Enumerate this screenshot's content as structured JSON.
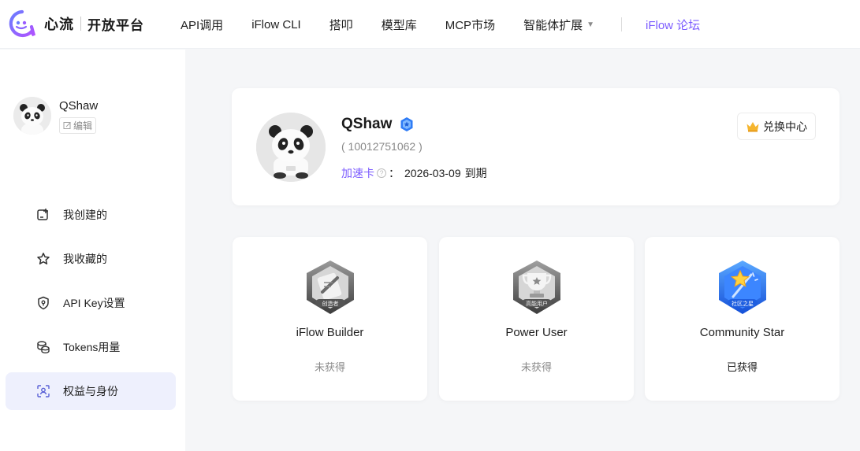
{
  "brand": {
    "name": "心流",
    "sub": "开放平台"
  },
  "nav": {
    "items": [
      {
        "label": "API调用"
      },
      {
        "label": "iFlow CLI"
      },
      {
        "label": "搭叩"
      },
      {
        "label": "模型库"
      },
      {
        "label": "MCP市场"
      },
      {
        "label": "智能体扩展"
      }
    ],
    "forum": "iFlow 论坛",
    "accent_color": "#7c5cff"
  },
  "sidebar": {
    "user": {
      "name": "QShaw",
      "edit_label": "编辑"
    },
    "menu": [
      {
        "label": "我创建的",
        "icon": "create-icon"
      },
      {
        "label": "我收藏的",
        "icon": "star-icon"
      },
      {
        "label": "API Key设置",
        "icon": "shield-key-icon"
      },
      {
        "label": "Tokens用量",
        "icon": "coins-icon"
      },
      {
        "label": "权益与身份",
        "icon": "identity-icon",
        "active": true
      }
    ]
  },
  "profile": {
    "name": "QShaw",
    "id": "( 10012751062 )",
    "card_label": "加速卡",
    "expiry_prefix": "：",
    "expiry_date": "2026-03-09",
    "expiry_suffix": "到期",
    "redeem_label": "兑换中心"
  },
  "badges": [
    {
      "title": "iFlow Builder",
      "badge_text": "创造者",
      "status": "未获得",
      "earned": false
    },
    {
      "title": "Power User",
      "badge_text": "高能用户",
      "status": "未获得",
      "earned": false
    },
    {
      "title": "Community Star",
      "badge_text": "社区之星",
      "status": "已获得",
      "earned": true
    }
  ]
}
